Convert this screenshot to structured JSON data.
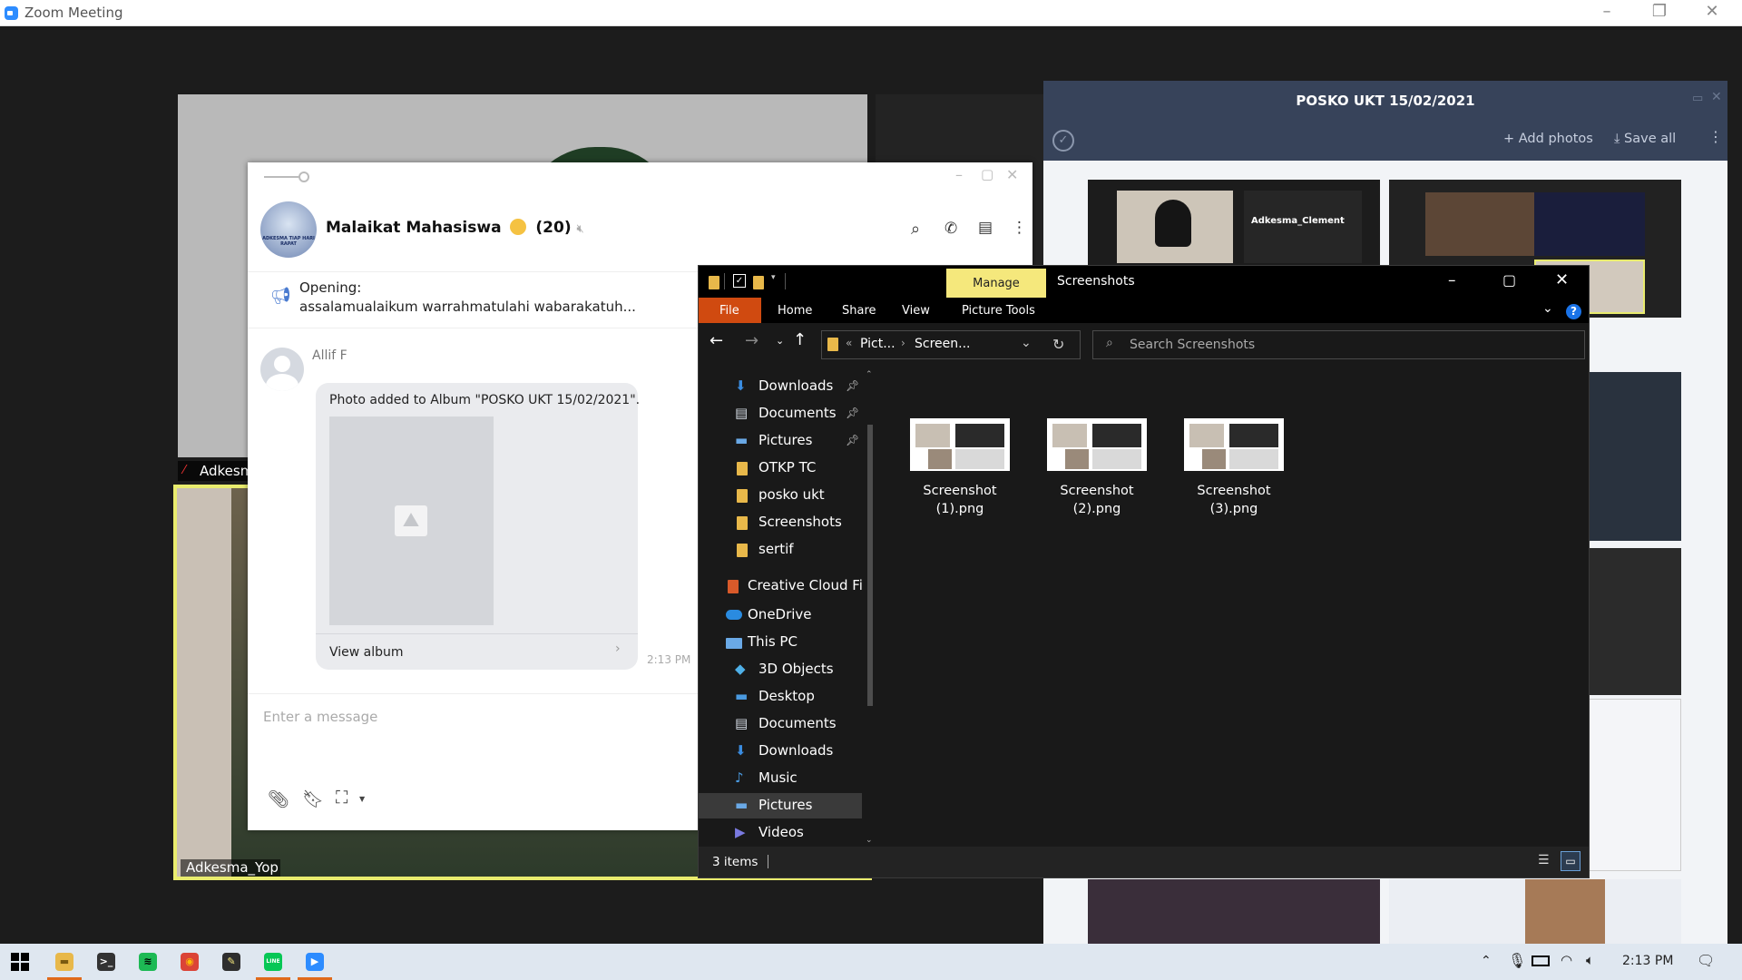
{
  "zoom": {
    "window_title": "Zoom Meeting",
    "participant_names": {
      "bottom_left": "Adkesma_Yop",
      "left_partial": "Adkesm"
    },
    "gallery": {
      "title": "POSKO UKT 15/02/2021",
      "add_photos": "Add photos",
      "save_all": "Save all",
      "thumb_label": "Adkesma_Clement"
    }
  },
  "chat": {
    "group_name": "Malaikat Mahasiswa",
    "member_count": "(20)",
    "opening_label": "Opening:",
    "opening_text": "assalamualaikum warrahmatulahi wabarakatuh...",
    "message": {
      "sender": "Allif F",
      "text": "Photo added to Album \"POSKO UKT 15/02/2021\".",
      "link": "View album",
      "time": "2:13 PM"
    },
    "input_placeholder": "Enter a message",
    "avatar_caption": "ADKESMA TIAP HARI RAPAT"
  },
  "explorer": {
    "manage": "Manage",
    "title": "Screenshots",
    "tabs": [
      "File",
      "Home",
      "Share",
      "View",
      "Picture Tools"
    ],
    "breadcrumb": [
      "Pict...",
      "Screen..."
    ],
    "search_placeholder": "Search Screenshots",
    "quick_access": [
      {
        "label": "Downloads",
        "icon": "download-arrow-icon",
        "pinned": true
      },
      {
        "label": "Documents",
        "icon": "document-icon",
        "pinned": true
      },
      {
        "label": "Pictures",
        "icon": "pictures-icon",
        "pinned": true
      },
      {
        "label": "OTKP TC",
        "icon": "folder-icon",
        "pinned": false
      },
      {
        "label": "posko ukt",
        "icon": "folder-icon",
        "pinned": false
      },
      {
        "label": "Screenshots",
        "icon": "folder-icon",
        "pinned": false
      },
      {
        "label": "sertif",
        "icon": "folder-icon",
        "pinned": false
      }
    ],
    "creative_cloud": "Creative Cloud File",
    "onedrive": "OneDrive",
    "this_pc": "This PC",
    "pc_items": [
      {
        "label": "3D Objects",
        "icon": "3d-objects-icon"
      },
      {
        "label": "Desktop",
        "icon": "desktop-icon"
      },
      {
        "label": "Documents",
        "icon": "document-icon"
      },
      {
        "label": "Downloads",
        "icon": "download-arrow-icon"
      },
      {
        "label": "Music",
        "icon": "music-note-icon"
      },
      {
        "label": "Pictures",
        "icon": "pictures-icon"
      },
      {
        "label": "Videos",
        "icon": "video-icon"
      }
    ],
    "files": [
      {
        "line1": "Screenshot",
        "line2": "(1).png"
      },
      {
        "line1": "Screenshot",
        "line2": "(2).png"
      },
      {
        "line1": "Screenshot",
        "line2": "(3).png"
      }
    ],
    "status": "3 items",
    "selected_nav": "Pictures"
  },
  "taskbar": {
    "time": "2:13 PM",
    "apps": [
      "file-explorer-icon",
      "terminal-icon",
      "spotify-icon",
      "chrome-icon",
      "notes-icon",
      "line-icon",
      "zoom-icon"
    ]
  },
  "colors": {
    "line_accent": "#06c755",
    "explorer_bg": "#191919",
    "manage_tab": "#f5e87c",
    "file_tab": "#d04a10",
    "zoom_blue": "#2d8cff",
    "active_speaker": "#f6f34a"
  }
}
